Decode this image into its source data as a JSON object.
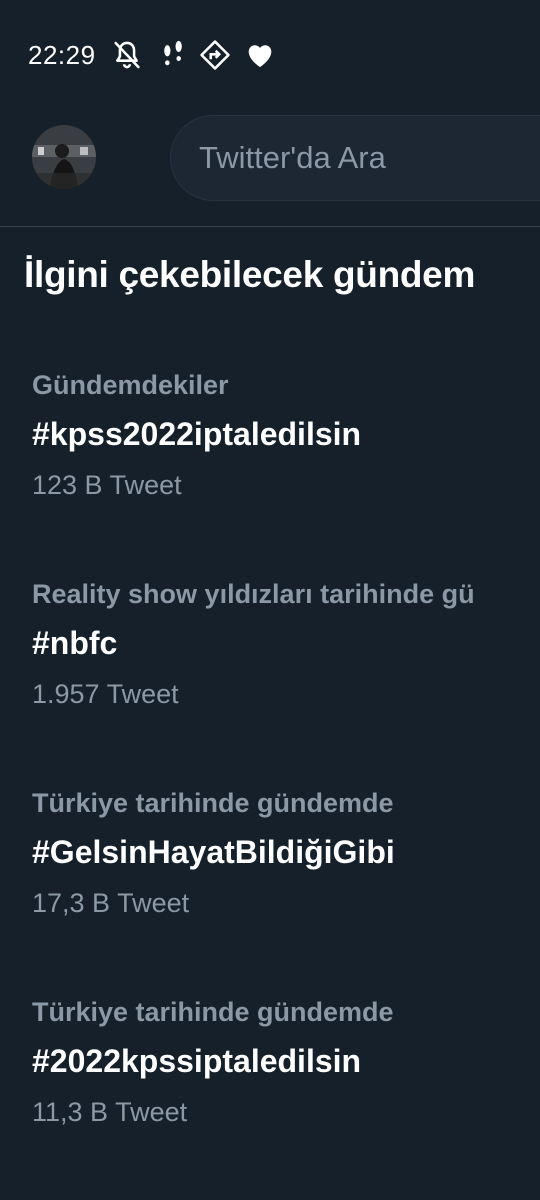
{
  "status_bar": {
    "time": "22:29",
    "icons": [
      "bell-off-icon",
      "footsteps-icon",
      "direction-sign-icon",
      "heart-icon"
    ]
  },
  "header": {
    "search_placeholder": "Twitter'da Ara"
  },
  "section": {
    "title": "İlgini çekebilecek gündem"
  },
  "trends": [
    {
      "context": "Gündemdekiler",
      "name": "#kpss2022iptaledilsin",
      "count": "123 B Tweet"
    },
    {
      "context": "Reality show yıldızları tarihinde gü",
      "name": "#nbfc",
      "count": "1.957 Tweet"
    },
    {
      "context": "Türkiye tarihinde gündemde",
      "name": "#GelsinHayatBildiğiGibi",
      "count": "17,3 B Tweet"
    },
    {
      "context": "Türkiye tarihinde gündemde",
      "name": "#2022kpssiptaledilsin",
      "count": "11,3 B Tweet"
    }
  ],
  "colors": {
    "background": "#15202b",
    "text_primary": "#ffffff",
    "text_secondary": "#8b98a5",
    "divider": "#38444d"
  }
}
